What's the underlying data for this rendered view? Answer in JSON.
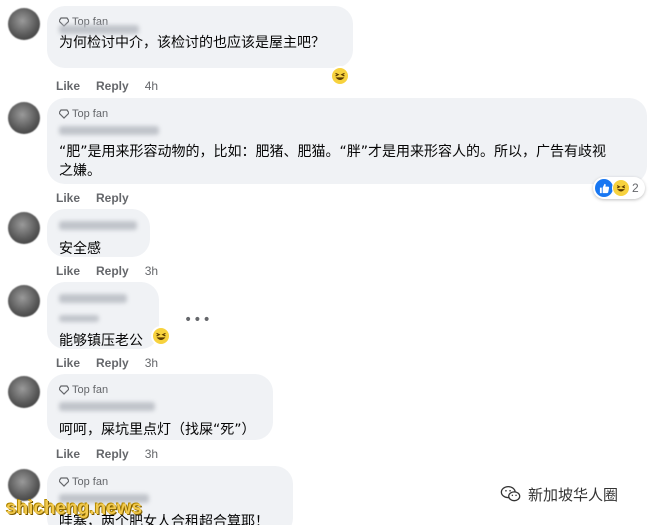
{
  "comments": [
    {
      "badge": "Top fan",
      "text": "为何检讨中介，该检讨的也应该是屋主吧？",
      "like": "Like",
      "reply": "Reply",
      "time": "4h"
    },
    {
      "badge": "Top fan",
      "text_line1": "“肥”是用来形容动物的，比如：肥猪、肥猫。“胖”才是用来形容人的。所以，广告有歧视",
      "text_line2": "之嫌。",
      "like": "Like",
      "reply": "Reply",
      "reaction_count": "2"
    },
    {
      "text": "安全感",
      "like": "Like",
      "reply": "Reply",
      "time": "3h"
    },
    {
      "text": "能够镇压老公",
      "like": "Like",
      "reply": "Reply",
      "time": "3h",
      "more": "•••"
    },
    {
      "badge": "Top fan",
      "text": "呵呵，屎坑里点灯（找屎“死”）",
      "like": "Like",
      "reply": "Reply",
      "time": "3h"
    },
    {
      "badge": "Top fan",
      "text": "哇塞，两个肥女人合租超合算耶！"
    }
  ],
  "watermark": {
    "site": "shicheng.news",
    "account": "新加坡华人圈"
  }
}
